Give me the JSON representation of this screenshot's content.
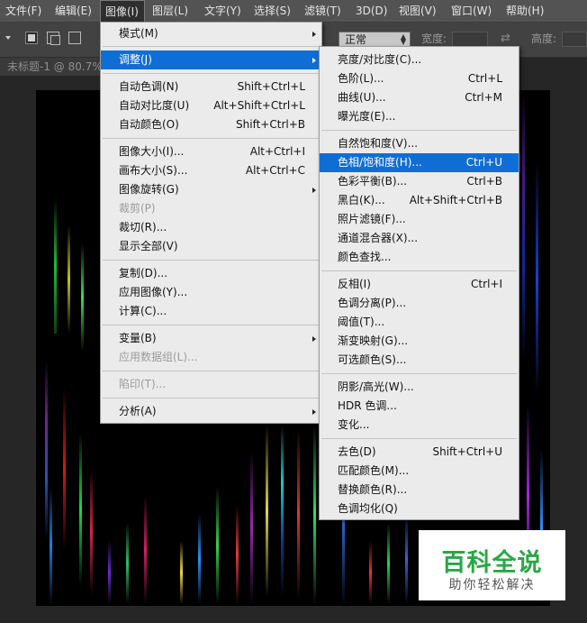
{
  "menubar": {
    "items": [
      "文件(F)",
      "编辑(E)",
      "图像(I)",
      "图层(L)",
      "文字(Y)",
      "选择(S)",
      "滤镜(T)",
      "3D(D)",
      "视图(V)",
      "窗口(W)",
      "帮助(H)"
    ]
  },
  "options": {
    "mode_value": "正常",
    "width_label": "宽度:",
    "height_label": "高度:"
  },
  "document_tab": "未标题-1 @ 80.7%",
  "image_menu": [
    {
      "label": "模式(M)",
      "submenu": true
    },
    {
      "label": "调整(J)",
      "submenu": true,
      "highlight": true
    },
    {
      "label": "自动色调(N)",
      "shortcut": "Shift+Ctrl+L"
    },
    {
      "label": "自动对比度(U)",
      "shortcut": "Alt+Shift+Ctrl+L"
    },
    {
      "label": "自动颜色(O)",
      "shortcut": "Shift+Ctrl+B"
    },
    {
      "label": "图像大小(I)...",
      "shortcut": "Alt+Ctrl+I"
    },
    {
      "label": "画布大小(S)...",
      "shortcut": "Alt+Ctrl+C"
    },
    {
      "label": "图像旋转(G)",
      "submenu": true
    },
    {
      "label": "裁剪(P)",
      "disabled": true
    },
    {
      "label": "裁切(R)..."
    },
    {
      "label": "显示全部(V)"
    },
    {
      "label": "复制(D)..."
    },
    {
      "label": "应用图像(Y)..."
    },
    {
      "label": "计算(C)..."
    },
    {
      "label": "变量(B)",
      "submenu": true
    },
    {
      "label": "应用数据组(L)...",
      "disabled": true
    },
    {
      "label": "陷印(T)...",
      "disabled": true
    },
    {
      "label": "分析(A)",
      "submenu": true
    }
  ],
  "adjust_menu": [
    {
      "label": "亮度/对比度(C)..."
    },
    {
      "label": "色阶(L)...",
      "shortcut": "Ctrl+L"
    },
    {
      "label": "曲线(U)...",
      "shortcut": "Ctrl+M"
    },
    {
      "label": "曝光度(E)..."
    },
    {
      "label": "自然饱和度(V)..."
    },
    {
      "label": "色相/饱和度(H)...",
      "shortcut": "Ctrl+U",
      "highlight": true
    },
    {
      "label": "色彩平衡(B)...",
      "shortcut": "Ctrl+B"
    },
    {
      "label": "黑白(K)...",
      "shortcut": "Alt+Shift+Ctrl+B"
    },
    {
      "label": "照片滤镜(F)..."
    },
    {
      "label": "通道混合器(X)..."
    },
    {
      "label": "颜色查找..."
    },
    {
      "label": "反相(I)",
      "shortcut": "Ctrl+I"
    },
    {
      "label": "色调分离(P)..."
    },
    {
      "label": "阈值(T)..."
    },
    {
      "label": "渐变映射(G)..."
    },
    {
      "label": "可选颜色(S)..."
    },
    {
      "label": "阴影/高光(W)..."
    },
    {
      "label": "HDR 色调..."
    },
    {
      "label": "变化..."
    },
    {
      "label": "去色(D)",
      "shortcut": "Shift+Ctrl+U"
    },
    {
      "label": "匹配颜色(M)..."
    },
    {
      "label": "替换颜色(R)..."
    },
    {
      "label": "色调均化(Q)"
    }
  ],
  "watermark": {
    "title": "百科全说",
    "subtitle": "助你轻松解决"
  },
  "colors": {
    "menubar": "#535353",
    "menu_bg": "#ebebeb",
    "highlight": "#0f6ed6",
    "canvas": "#000000",
    "watermark_green": "#2aa745"
  }
}
